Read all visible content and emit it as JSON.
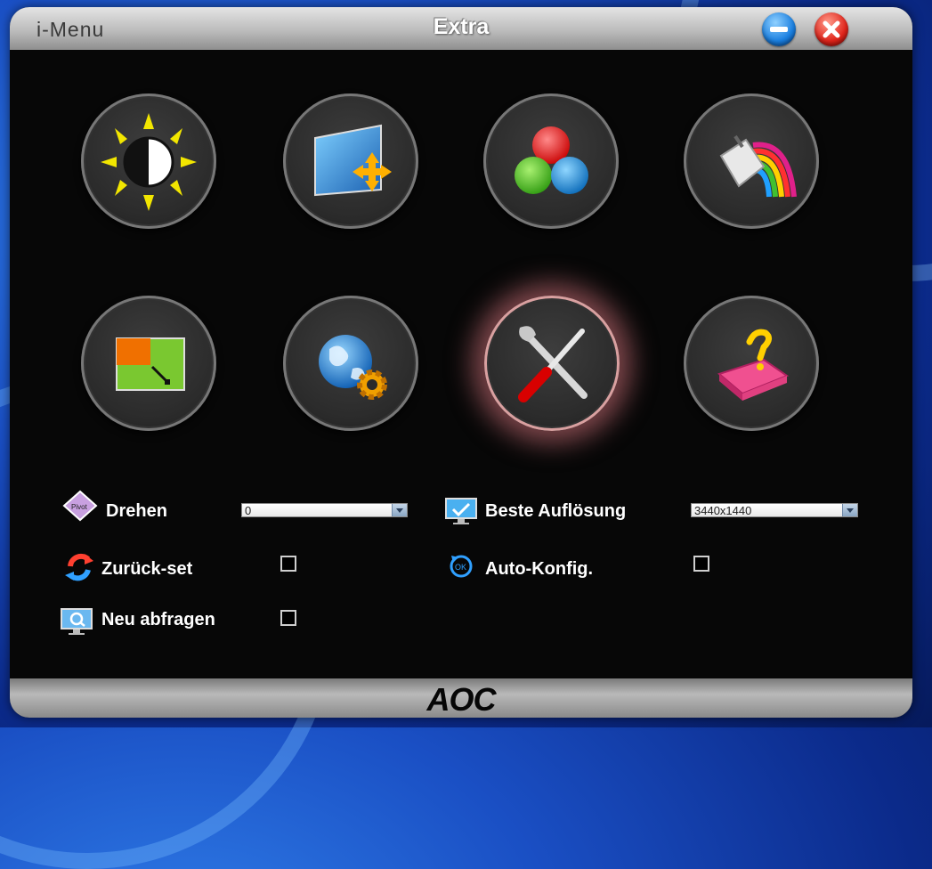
{
  "window": {
    "app_title": "i-Menu",
    "section_title": "Extra",
    "minimize_icon": "minimize-icon",
    "close_icon": "close-icon"
  },
  "menu_icons": [
    {
      "name": "luminance-icon"
    },
    {
      "name": "image-setup-icon"
    },
    {
      "name": "color-setup-icon"
    },
    {
      "name": "picture-boost-icon"
    },
    {
      "name": "osd-setup-icon"
    },
    {
      "name": "game-setting-icon"
    },
    {
      "name": "extra-tools-icon",
      "active": true
    },
    {
      "name": "exit-icon"
    }
  ],
  "options": {
    "rotate": {
      "label": "Drehen",
      "value": "0"
    },
    "best_resolution": {
      "label": "Beste Auflösung",
      "value": "3440x1440"
    },
    "reset": {
      "label": "Zurück-set"
    },
    "auto_config": {
      "label": "Auto-Konfig."
    },
    "requery": {
      "label": "Neu abfragen"
    }
  },
  "footer": {
    "logo": "AOC"
  },
  "colors": {
    "accent_blue": "#1a7fe0",
    "close_red": "#e0241a",
    "active_glow": "#dc7882",
    "panel_bg": "#070707"
  }
}
